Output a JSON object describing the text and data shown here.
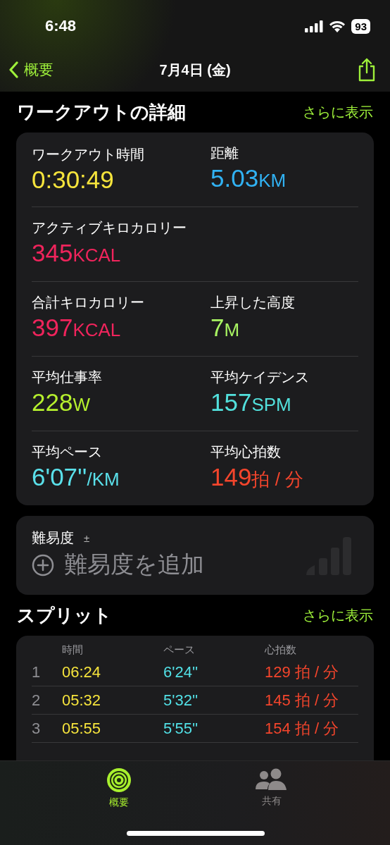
{
  "status_bar": {
    "time": "6:48",
    "battery": "93"
  },
  "nav": {
    "back": "概要",
    "title": "7月4日 (金)"
  },
  "details": {
    "title": "ワークアウトの詳細",
    "more": "さらに表示",
    "rows": [
      [
        {
          "label": "ワークアウト時間",
          "value": "0:30:49",
          "color": "#f6e43c"
        },
        {
          "label": "距離",
          "value": "5.03",
          "unit": "KM",
          "color": "#31b2f3"
        }
      ],
      [
        {
          "label": "アクティブキロカロリー",
          "value": "345",
          "unit": "KCAL",
          "color": "#f0245c"
        }
      ],
      [
        {
          "label": "合計キロカロリー",
          "value": "397",
          "unit": "KCAL",
          "color": "#f0245c"
        },
        {
          "label": "上昇した高度",
          "value": "7",
          "unit": "M",
          "color": "#a8f462"
        }
      ],
      [
        {
          "label": "平均仕事率",
          "value": "228",
          "unit": "W",
          "color": "#b6f02e"
        },
        {
          "label": "平均ケイデンス",
          "value": "157",
          "unit": "SPM",
          "color": "#52e0dc"
        }
      ],
      [
        {
          "label": "平均ペース",
          "value": "6'07''",
          "unit": "/KM",
          "color": "#5ae0ea"
        },
        {
          "label": "平均心拍数",
          "value": "149",
          "unit": "拍 / 分",
          "color": "#f4452c"
        }
      ]
    ]
  },
  "effort": {
    "label": "難易度",
    "sign": "±",
    "placeholder": "難易度を追加"
  },
  "splits": {
    "title": "スプリット",
    "more": "さらに表示",
    "columns": [
      "時間",
      "ペース",
      "心拍数"
    ],
    "rows": [
      {
        "index": "1",
        "time": "06:24",
        "pace": "6'24''",
        "heart_rate": "129 拍 / 分"
      },
      {
        "index": "2",
        "time": "05:32",
        "pace": "5'32''",
        "heart_rate": "145 拍 / 分"
      },
      {
        "index": "3",
        "time": "05:55",
        "pace": "5'55''",
        "heart_rate": "154 拍 / 分"
      }
    ]
  },
  "tabs": [
    {
      "label": "概要",
      "kind": "summary",
      "selected": true
    },
    {
      "label": "共有",
      "kind": "sharing",
      "selected": false
    }
  ]
}
